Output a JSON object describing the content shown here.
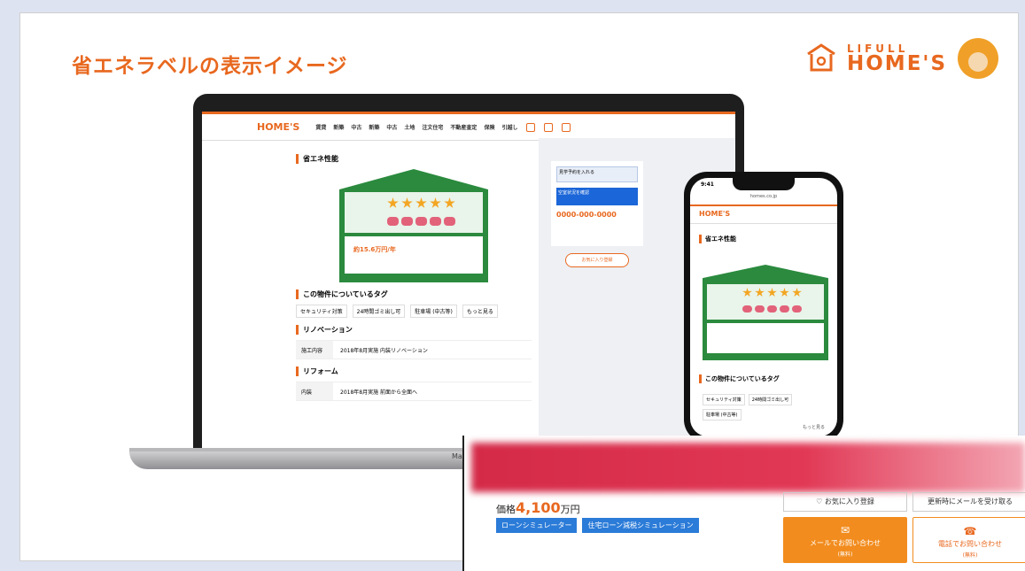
{
  "slide": {
    "title": "省エネラベルの表示イメージ"
  },
  "brand": {
    "line1": "LIFULL",
    "line2": "HOME'S"
  },
  "laptop": {
    "logo": "HOME'S",
    "nav": [
      "賃貸",
      "新築",
      "中古",
      "新築",
      "中古",
      "土地",
      "注文住宅",
      "不動産査定",
      "保険",
      "引越し"
    ],
    "section_energy": "省エネ性能",
    "section_tags": "この物件についているタグ",
    "tags": [
      "セキュリティ対策",
      "24時間ゴミ出し可",
      "駐車場 (中古等)",
      "もっと見る"
    ],
    "section_renovation": "リノベーション",
    "renovation_row": {
      "key": "施工内容",
      "value": "2018年8月実施 内装リノベーション"
    },
    "section_reform": "リフォーム",
    "reform_row": {
      "key": "内装",
      "value": "2018年8月実施 前面から全面へ"
    },
    "label_price": "約15.6万円/年",
    "side_btn1": "見学予約を入れる",
    "side_btn2": "空室状況を確認",
    "side_tel": "0000-000-0000",
    "side_fav": "お気に入り登録",
    "base_text": "MacBook"
  },
  "phone": {
    "time": "9:41",
    "url": "homes.co.jp",
    "logo": "HOME'S",
    "section_energy": "省エネ性能",
    "section_tags": "この物件についているタグ",
    "tags": [
      "セキュリティ対策",
      "24時間ゴミ出し可",
      "駐車場 (中古等)"
    ],
    "more": "もっと見る"
  },
  "bottom": {
    "price_label": "価格",
    "price_value": "4,100",
    "price_unit": "万円",
    "loan_sim": "ローンシミュレーター",
    "loan_tax": "住宅ローン減税シミュレーション",
    "fav": "♡ お気に入り登録",
    "notify": "更新時にメールを受け取る",
    "mail_btn": "メールでお問い合わせ",
    "mail_sub": "(無料)",
    "tel_btn": "電話でお問い合わせ",
    "tel_sub": "(無料)"
  }
}
